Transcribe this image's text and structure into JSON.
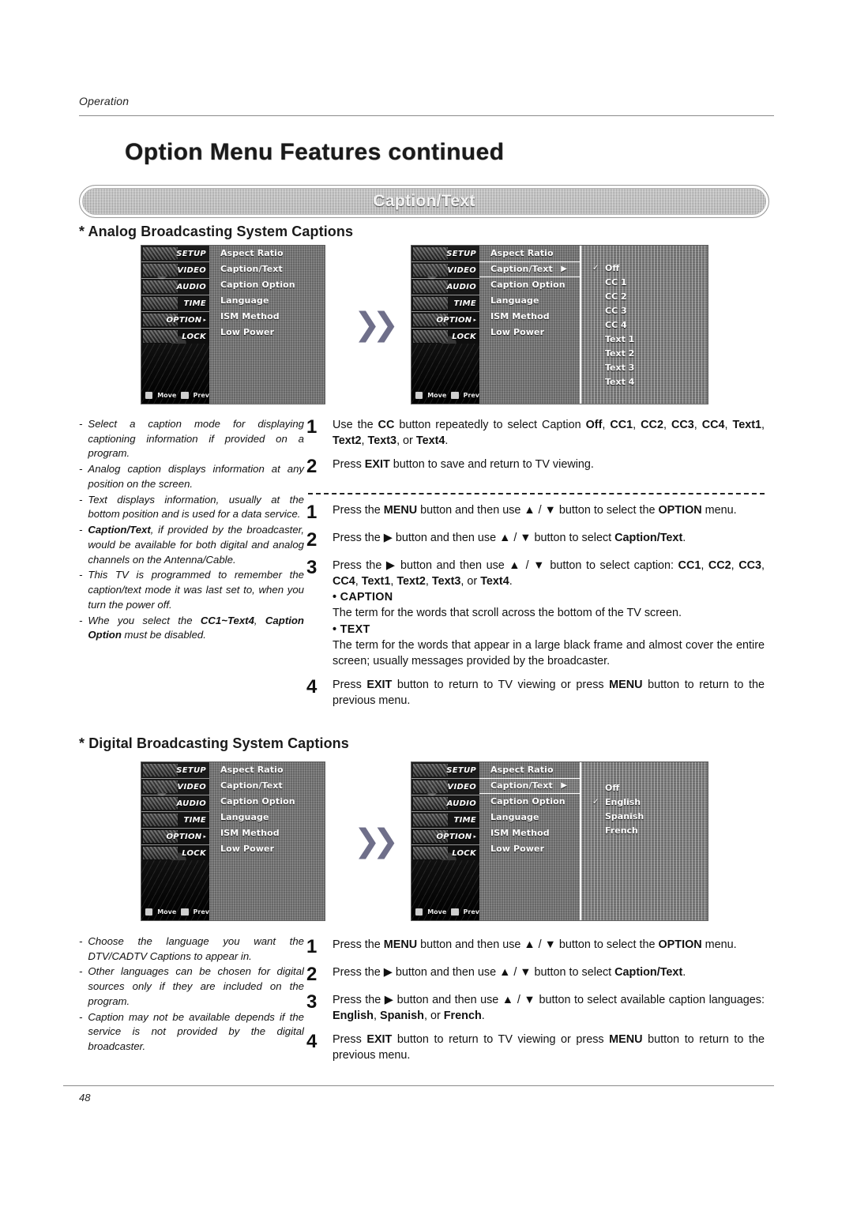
{
  "runninghead": "Operation",
  "page_title": "Option Menu Features continued",
  "banner_label": "Caption/Text",
  "page_number": "48",
  "sections": {
    "analog_heading": "* Analog Broadcasting System Captions",
    "digital_heading": "* Digital Broadcasting System Captions"
  },
  "osd": {
    "icon_items": [
      {
        "label": "SETUP",
        "selected": false
      },
      {
        "label": "VIDEO",
        "selected": false
      },
      {
        "label": "AUDIO",
        "selected": false
      },
      {
        "label": "TIME",
        "selected": false
      },
      {
        "label": "OPTION",
        "selected": true
      },
      {
        "label": "LOCK",
        "selected": false
      }
    ],
    "menu_items": [
      "Aspect Ratio",
      "Caption/Text",
      "Caption Option",
      "Language",
      "ISM Method",
      "Low Power"
    ],
    "submenu_arrow": "▶",
    "nav_move": "Move",
    "nav_prev": "Prev",
    "analog_submenu": [
      {
        "label": "Off",
        "checked": true
      },
      {
        "label": "CC 1",
        "checked": false
      },
      {
        "label": "CC 2",
        "checked": false
      },
      {
        "label": "CC 3",
        "checked": false
      },
      {
        "label": "CC 4",
        "checked": false
      },
      {
        "label": "Text 1",
        "checked": false
      },
      {
        "label": "Text 2",
        "checked": false
      },
      {
        "label": "Text 3",
        "checked": false
      },
      {
        "label": "Text 4",
        "checked": false
      }
    ],
    "digital_submenu": [
      {
        "label": "Off",
        "checked": false
      },
      {
        "label": "English",
        "checked": true
      },
      {
        "label": "Spanish",
        "checked": false
      },
      {
        "label": "French",
        "checked": false
      }
    ],
    "check_glyph": "✓",
    "transition_glyph": "❯❯"
  },
  "analog_notes": [
    "Select a caption mode for displaying captioning information if provided on a program.",
    "Analog caption displays information at any position on the screen.",
    "Text displays information, usually at the bottom position and is used for a data service.",
    "Caption/Text, if provided by the broadcaster, would be available for both digital and analog channels on the Antenna/Cable.",
    "This TV is programmed to remember the caption/text mode it was last set to, when you turn the power off.",
    "Whe you select the CC1~Text4, Caption Option  must be disabled."
  ],
  "digital_notes": [
    "Choose the language you want the DTV/CADTV Captions to appear in.",
    "Other languages can be chosen for digital sources only if they are included on the program.",
    "Caption may not be available depends if the service is not provided by the digital broadcaster."
  ],
  "analog_steps_top": [
    {
      "num": "1",
      "text": "Use the CC button repeatedly to select Caption Off, CC1, CC2, CC3, CC4, Text1, Text2, Text3, or Text4."
    },
    {
      "num": "2",
      "text": "Press EXIT button to save and return to TV viewing."
    }
  ],
  "analog_steps_bottom": [
    {
      "num": "1",
      "text": "Press the MENU button and then use ▲ / ▼  button to select the OPTION menu."
    },
    {
      "num": "2",
      "text": "Press the ▶ button and then use ▲ / ▼ button to select Caption/Text."
    },
    {
      "num": "3",
      "text": "Press the ▶ button and then use ▲ / ▼ button to select caption: CC1, CC2, CC3, CC4, Text1, Text2, Text3, or Text4."
    },
    {
      "num": "4",
      "text": "Press EXIT button to return to TV viewing or press MENU button to return to the previous menu."
    }
  ],
  "definitions": {
    "caption_title": "• CAPTION",
    "caption_body": "The term for the words that scroll across the bottom of the TV screen.",
    "text_title": "• TEXT",
    "text_body": "The term for the words that appear in a large black frame and almost cover the entire screen; usually messages provided by the broadcaster."
  },
  "digital_steps": [
    {
      "num": "1",
      "text": "Press the MENU button and then use ▲ / ▼  button to select the OPTION menu."
    },
    {
      "num": "2",
      "text": "Press the ▶ button and then use ▲ / ▼ button to select Caption/Text."
    },
    {
      "num": "3",
      "text": "Press the ▶ button and then use ▲ / ▼ button to select available caption languages: English, Spanish, or French."
    },
    {
      "num": "4",
      "text": "Press EXIT button to return to TV viewing or press MENU button to return to the previous menu."
    }
  ]
}
